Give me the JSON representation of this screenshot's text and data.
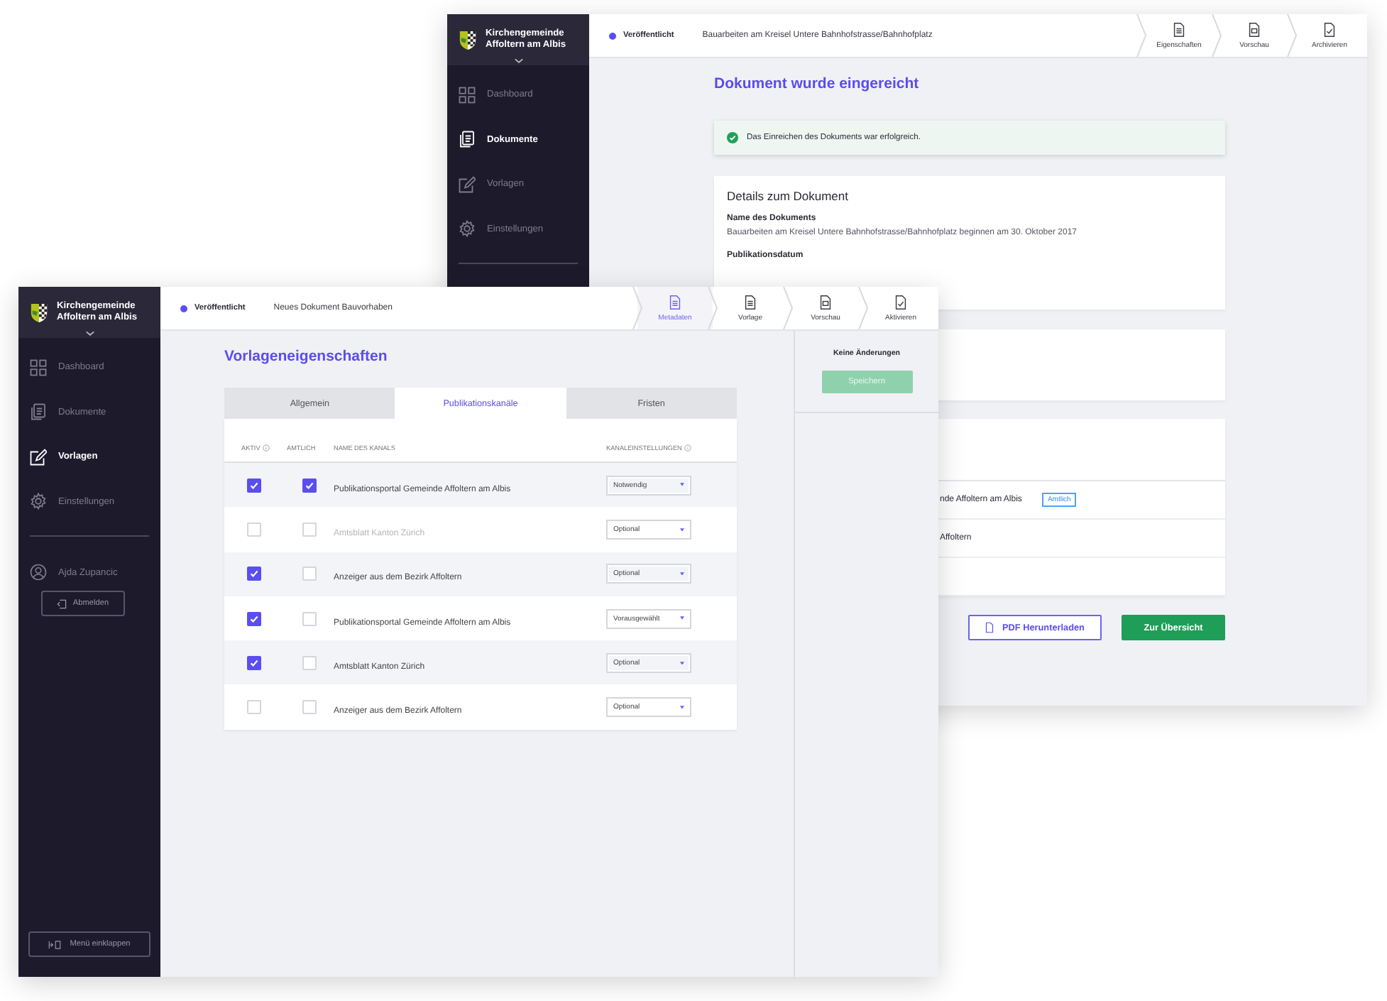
{
  "back_window": {
    "org_name": "Kirchengemeinde Affoltern am Albis",
    "status": "Veröffentlicht",
    "document_title": "Bauarbeiten am Kreisel Untere Bahnhofstrasse/Bahnhofplatz",
    "steps": [
      {
        "label": "Eigenschaften",
        "kind": "doc",
        "selected": false
      },
      {
        "label": "Vorschau",
        "kind": "preview",
        "selected": false
      },
      {
        "label": "Archivieren",
        "kind": "check",
        "selected": false
      }
    ],
    "nav": [
      {
        "label": "Dashboard",
        "kind": "grid",
        "selected": false
      },
      {
        "label": "Dokumente",
        "kind": "docs",
        "selected": true
      },
      {
        "label": "Vorlagen",
        "kind": "edit",
        "selected": false
      },
      {
        "label": "Einstellungen",
        "kind": "gear",
        "selected": false
      }
    ],
    "heading": "Dokument wurde eingereicht",
    "alert": "Das Einreichen des Dokuments war erfolgreich.",
    "details": {
      "title": "Details zum Dokument",
      "fields": [
        {
          "label": "Name des Dokuments",
          "value": "Bauarbeiten am Kreisel Untere Bahnhofstrasse/Bahnhofplatz beginnen am 30. Oktober 2017"
        },
        {
          "label": "Publikationsdatum"
        }
      ]
    },
    "channel_rows": [
      {
        "name": "nde Affoltern am Albis",
        "tag": "Amtlich"
      },
      {
        "name": "Affoltern"
      },
      {}
    ],
    "buttons": [
      {
        "label": "PDF Herunterladen",
        "kind": "outline"
      },
      {
        "label": "Zur Übersicht",
        "kind": "primary"
      }
    ]
  },
  "front_window": {
    "org_name": "Kirchengemeinde Affoltern am Albis",
    "status": "Veröffentlicht",
    "document_title": "Neues Dokument Bauvorhaben",
    "steps": [
      {
        "label": "Metadaten",
        "kind": "doc",
        "selected": true
      },
      {
        "label": "Vorlage",
        "kind": "doc",
        "selected": false
      },
      {
        "label": "Vorschau",
        "kind": "preview",
        "selected": false
      },
      {
        "label": "Aktivieren",
        "kind": "check",
        "selected": false
      }
    ],
    "nav": [
      {
        "label": "Dashboard",
        "kind": "grid",
        "selected": false
      },
      {
        "label": "Dokumente",
        "kind": "docs",
        "selected": false
      },
      {
        "label": "Vorlagen",
        "kind": "edit",
        "selected": true
      },
      {
        "label": "Einstellungen",
        "kind": "gear",
        "selected": false
      }
    ],
    "user": {
      "name": "Ajda Zupancic",
      "logout": "Abmelden"
    },
    "collapse": "Menü einklappen",
    "heading": "Vorlageneigenschaften",
    "tabs": [
      {
        "label": "Allgemein",
        "selected": false
      },
      {
        "label": "Publikationskanäle",
        "selected": true
      },
      {
        "label": "Fristen",
        "selected": false
      }
    ],
    "table": {
      "columns": [
        {
          "label": "AKTIV",
          "info": true
        },
        {
          "label": "AMTLICH",
          "info": false
        },
        {
          "label": "NAME DES KANALS",
          "info": false
        },
        {
          "label": "KANALEINSTELLUNGEN",
          "info": true
        }
      ],
      "rows": [
        {
          "active": true,
          "official": true,
          "name": "Publikationsportal Gemeinde Affoltern am Albis",
          "disabled": false,
          "setting": "Notwendig"
        },
        {
          "active": false,
          "official": false,
          "name": "Amtsblatt Kanton Zürich",
          "disabled": true,
          "setting": "Optional"
        },
        {
          "active": true,
          "official": false,
          "name": "Anzeiger aus dem Bezirk Affoltern",
          "disabled": false,
          "setting": "Optional"
        },
        {
          "active": true,
          "official": false,
          "name": "Publikationsportal Gemeinde Affoltern am Albis",
          "disabled": false,
          "setting": "Vorausgewählt"
        },
        {
          "active": true,
          "official": false,
          "name": "Amtsblatt Kanton Zürich",
          "disabled": false,
          "setting": "Optional"
        },
        {
          "active": false,
          "official": false,
          "name": "Anzeiger aus dem Bezirk Affoltern",
          "disabled": false,
          "setting": "Optional"
        }
      ]
    },
    "side_panel": {
      "status": "Keine Änderungen",
      "save": "Speichern",
      "save_disabled": true
    }
  }
}
